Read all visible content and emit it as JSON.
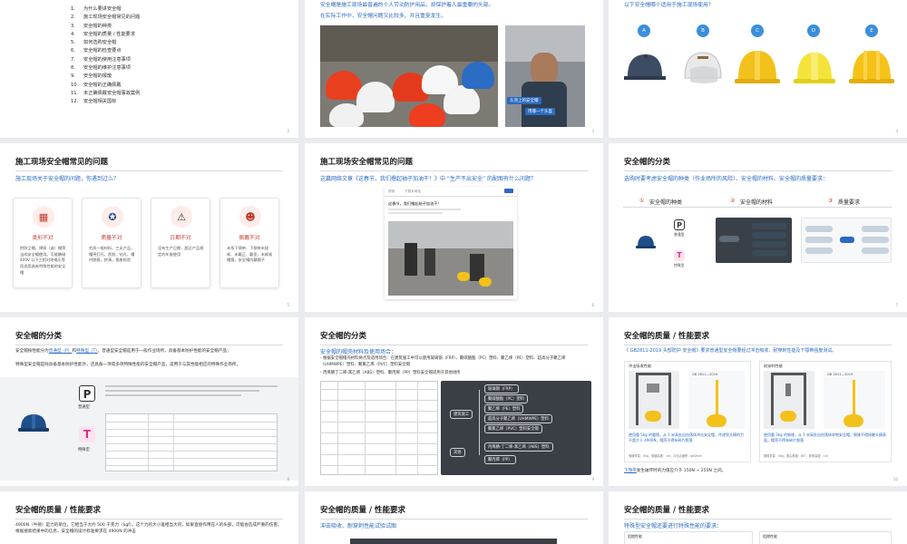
{
  "slides": {
    "s1": {
      "toc": [
        {
          "num": "1.",
          "label": "为什么要讲安全帽"
        },
        {
          "num": "2.",
          "label": "施工现场安全帽常见的问题"
        },
        {
          "num": "3.",
          "label": "安全帽的种类"
        },
        {
          "num": "4.",
          "label": "安全帽的质量 / 性能要求"
        },
        {
          "num": "5.",
          "label": "如何选购安全帽"
        },
        {
          "num": "6.",
          "label": "安全帽的检查要点"
        },
        {
          "num": "7.",
          "label": "安全帽的使用注意事项"
        },
        {
          "num": "8.",
          "label": "安全帽的维护注意事项"
        },
        {
          "num": "9.",
          "label": "安全帽的报废"
        },
        {
          "num": "10.",
          "label": "安全帽的正确佩戴"
        },
        {
          "num": "11.",
          "label": "未正确佩戴安全帽事故案例"
        },
        {
          "num": "12.",
          "label": "安全帽相关国标"
        }
      ],
      "page": "2"
    },
    "s2": {
      "line1": "安全帽是施工现场最普遍的个人劳动防护用品，却保护着人最重要的头部。",
      "line2": "在实际工作中，安全帽问题又比较多、并且重复发生。",
      "cap1": "头顶上的安全帽",
      "cap2": "用哪一个头盔",
      "page": "3"
    },
    "s3": {
      "question": "以下安全帽哪个适用于施工现场使用？",
      "options": [
        "A",
        "B",
        "C",
        "D",
        "E"
      ],
      "page": "4"
    },
    "s4": {
      "title": "施工现场安全帽常见的问题",
      "sub": "施工现场关于安全帽的问题，你遇到过么？",
      "cards": [
        {
          "head": "类形不对",
          "text": "把防尘帽、焊接（或）帽等当成安全帽使用。可能触碰 400V 以下三相对地电压等而选用具有特殊性能的安全帽"
        },
        {
          "head": "质量不对",
          "text": "劣质一般材料，三无产品，帽壳打孔，刮划、钻孔，帽衬脱损，拼凑，报废检验"
        },
        {
          "head": "日期不对",
          "text": "没有生产日期，超过产品规定的年限使用"
        },
        {
          "head": "佩戴不对",
          "text": "未系下颚带、下颚带未拔紧、未戴正、戴歪，未卸紧帽箍，安全帽内戴帽子"
        }
      ],
      "page": "5"
    },
    "s5": {
      "title": "施工现场安全帽常见的问题",
      "sub": "这篇网络文章《这春节，我们撸起袖子加油干！》中 “生产不出安全” 的配图有什么问题？",
      "search_placeholder": "搜索",
      "search_label": "下载本网站",
      "article_text": "这春节，我们撸起袖子加油干！",
      "page": "6"
    },
    "s6": {
      "title": "安全帽的分类",
      "sub": "选购时要考虑安全帽的种类（作业场所的风险）、安全帽的材料、安全帽的质量要求：",
      "h1": "安全帽的种类",
      "h2": "安全帽的材料",
      "h3": "质量要求",
      "n1": "①",
      "n2": "②",
      "n3": "③",
      "type_p": "P",
      "type_p_label": "普通型",
      "type_t": "T",
      "type_t_label": "特殊型",
      "page": "7"
    },
    "s7": {
      "title": "安全帽的分类",
      "sub": "安全帽按性能分为",
      "sub_p": "普通型（P）",
      "sub_mid": "和",
      "sub_t": "特殊型（T）",
      "sub_rest": "。普通型安全帽是用于一般作业场所，具备基本防护性能的安全帽产品；",
      "line2": "特殊型安全帽是除具备基本防护性能外，还具备一项或多项特殊性能的安全帽产品，适用于与其性能相应的特殊作业场所。",
      "p_label": "普通型",
      "t_label": "特殊型",
      "page": "8"
    },
    "s8": {
      "title": "安全帽的分类",
      "sub": "安全帽的帽壳材料及使用场合：",
      "bullet1": "- 根据安全帽帽壳材料将点及适用场合：在建筑施工中可以使用玻璃钢（FRP）、聚碳酸酯（PC）塑料、聚乙烯（PE）塑料、超高分子聚乙烯（UHMWPE）塑料、聚氯乙烯（PVC）塑料安全帽",
      "bullet2": "- 丙烯腈丁二烯-苯乙烯（ABS）塑料、聚丙烯（PP）塑料安全帽适用于其他场所",
      "mm_center1": "建筑施工",
      "mm_center2": "其他",
      "mm_nodes": [
        "玻璃钢（FRP）",
        "聚碳酸酯（PC）塑料",
        "聚乙烯（PE）塑料",
        "超高分子聚乙烯（UHMWPE）塑料",
        "聚氯乙烯（PVC）塑料安全帽",
        "丙烯腈-丁二烯-苯乙烯（ABS）塑料",
        "聚丙烯（PP）"
      ],
      "page": "9"
    },
    "s9": {
      "title": "安全帽的质量 / 性能要求",
      "sub": "《 GB2811-2019 头部防护 安全帽》要求普通型安全帽要经过冲击吸收、耐穿刺性能及下颚带强度测试。",
      "label_left": "冲击吸收性能",
      "label_right": "耐穿刺性能",
      "std_left": "GB 2811—2019",
      "std_right": "GB 2811—2019",
      "cap_left": "使用重 5kg 的重锤，从 1 米高处自由落体冲击安全帽，传递到头模的力不超大于 4900N，帽壳不得有碎片脱落",
      "cap_right": "使用重 3kg 的钢锥，从 1 米高处自由落体穿刺安全帽，钢锥不得接触头模表面，帽壳不得有碎片脱落",
      "fine_left": "落锤重量：5kg，落锤高度：1m，冲击点面积：φ50mm",
      "fine_right": "钢锥重量：3kg，锥尖角度：60°，穿刺高度：1m",
      "bottom_link": "下颚带",
      "bottom_text": "发生破坏时的力值应介于 150N ~ 250N 之间。",
      "page": "10"
    },
    "s10": {
      "title": "安全帽的质量 / 性能要求",
      "text": "4900N（牛顿）是力的单位，它相当于大约 500 千克力（kgf）。这个力的大小差相当大的，如果直接作用在人的头部，可能会造成严重的伤害。根据搜索结果中的信息，安全帽的设计标准要求在 4900N 的冲击"
    },
    "s11": {
      "title": "安全帽的质量 / 性能要求",
      "sub": "冲击吸收、耐穿刺性能试验试图"
    },
    "s12": {
      "title": "安全帽的质量 / 性能要求",
      "sub": "特殊型安全帽还要进行特殊性能的要求：",
      "col1": "阻燃性能",
      "col2": "阻燃性能"
    }
  },
  "colors": {
    "accent_blue": "#2a6ac0",
    "option_blue": "#3b8fd9",
    "warn_red": "#c0392b",
    "dark_panel": "#3a3f46"
  }
}
